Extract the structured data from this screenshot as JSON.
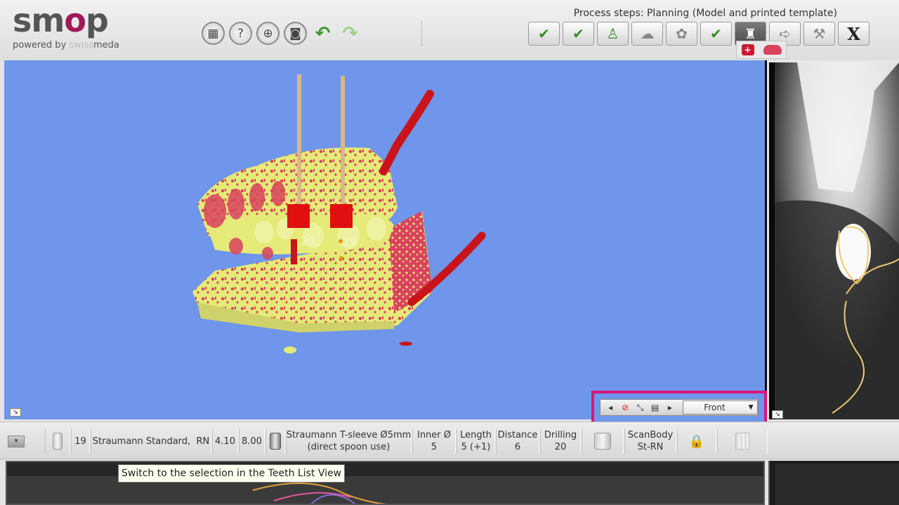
{
  "app": {
    "logo_left": "sm",
    "logo_o": "o",
    "logo_right": "p",
    "powered_by": "powered by",
    "brand_faint": "swiss",
    "brand_strong": "meda"
  },
  "toolbar": {
    "save_icon": "▦",
    "help_icon": "?",
    "add_icon": "⊕",
    "camera_icon": "◙",
    "undo_icon": "↶",
    "redo_icon": "↷"
  },
  "process": {
    "label": "Process steps: Planning (Model and printed template)",
    "steps": [
      {
        "glyph": "✔"
      },
      {
        "glyph": "✔"
      },
      {
        "glyph": "♙"
      },
      {
        "glyph": "☁"
      },
      {
        "glyph": "✿"
      },
      {
        "glyph": "✔"
      },
      {
        "glyph": "♜"
      },
      {
        "glyph": "➪"
      },
      {
        "glyph": "⚒"
      },
      {
        "glyph": "X"
      }
    ]
  },
  "view3d": {
    "label_20": "20",
    "label_19": "19",
    "background": "#6f96ea",
    "model_color": "#e5ea78",
    "tissue_color": "#d9435e",
    "sleeve_color": "#e01010",
    "nerve_color": "#c8141a"
  },
  "view_controls": {
    "prev": "◂",
    "cross": "⊘",
    "expand": "⤡",
    "panel": "▤",
    "next": "▸",
    "view_value": "Front",
    "caret": "▼"
  },
  "implant_bar": {
    "menu_btn": "▾",
    "tooth": "19",
    "implant_name": "Straumann Standard,",
    "implant_type": "RN",
    "diameter": "4.10",
    "length": "8.00",
    "sleeve_line1": "Straumann T-sleeve Ø5mm",
    "sleeve_line2": "(direct spoon use)",
    "inner_label": "Inner Ø",
    "inner_value": "5",
    "length_label": "Length",
    "length_value": "5 (+1)",
    "distance_label": "Distance",
    "distance_value": "6",
    "drilling_label": "Drilling",
    "drilling_value": "20",
    "scanbody_line1": "ScanBody",
    "scanbody_line2": "St-RN",
    "lock_icon": "🔒"
  },
  "tooltip": {
    "text": "Switch to the selection in the Teeth List View"
  }
}
